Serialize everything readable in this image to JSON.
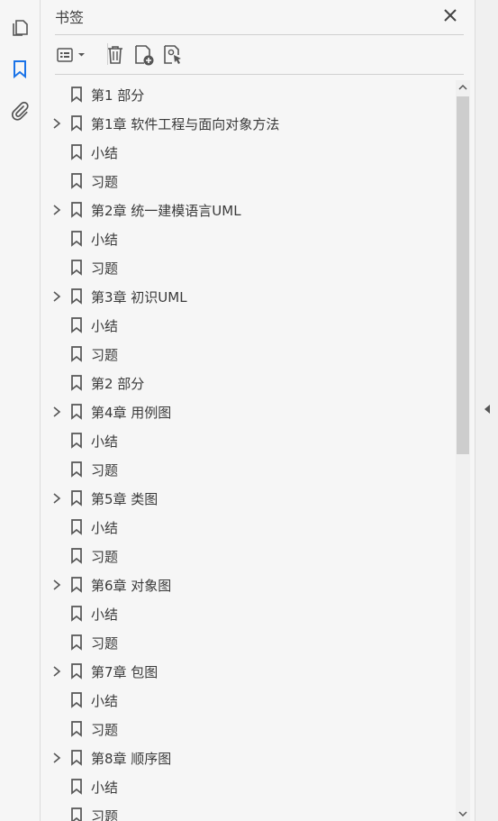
{
  "panel": {
    "title": "书签"
  },
  "rail": {
    "icons": [
      "pages-icon",
      "bookmark-icon",
      "attachment-icon"
    ]
  },
  "toolbar": {
    "buttons": [
      "options-menu-icon",
      "delete-icon",
      "new-bookmark-icon",
      "bookmark-from-selection-icon"
    ]
  },
  "colors": {
    "accent": "#1a73e8",
    "icon": "#555555",
    "text": "#3a3a3a",
    "scroll_thumb": "#cdcdcd"
  },
  "bookmarks": [
    {
      "label": "第1 部分",
      "expandable": false
    },
    {
      "label": "第1章 软件工程与面向对象方法",
      "expandable": true
    },
    {
      "label": "小结",
      "expandable": false
    },
    {
      "label": "习题",
      "expandable": false
    },
    {
      "label": "第2章 统一建模语言UML",
      "expandable": true
    },
    {
      "label": "小结",
      "expandable": false
    },
    {
      "label": "习题",
      "expandable": false
    },
    {
      "label": "第3章 初识UML",
      "expandable": true
    },
    {
      "label": "小结",
      "expandable": false
    },
    {
      "label": "习题",
      "expandable": false
    },
    {
      "label": "第2 部分",
      "expandable": false
    },
    {
      "label": "第4章 用例图",
      "expandable": true
    },
    {
      "label": "小结",
      "expandable": false
    },
    {
      "label": "习题",
      "expandable": false
    },
    {
      "label": "第5章 类图",
      "expandable": true
    },
    {
      "label": "小结",
      "expandable": false
    },
    {
      "label": "习题",
      "expandable": false
    },
    {
      "label": "第6章 对象图",
      "expandable": true
    },
    {
      "label": "小结",
      "expandable": false
    },
    {
      "label": "习题",
      "expandable": false
    },
    {
      "label": "第7章 包图",
      "expandable": true
    },
    {
      "label": "小结",
      "expandable": false
    },
    {
      "label": "习题",
      "expandable": false
    },
    {
      "label": "第8章 顺序图",
      "expandable": true
    },
    {
      "label": "小结",
      "expandable": false
    },
    {
      "label": "习题",
      "expandable": false
    }
  ]
}
